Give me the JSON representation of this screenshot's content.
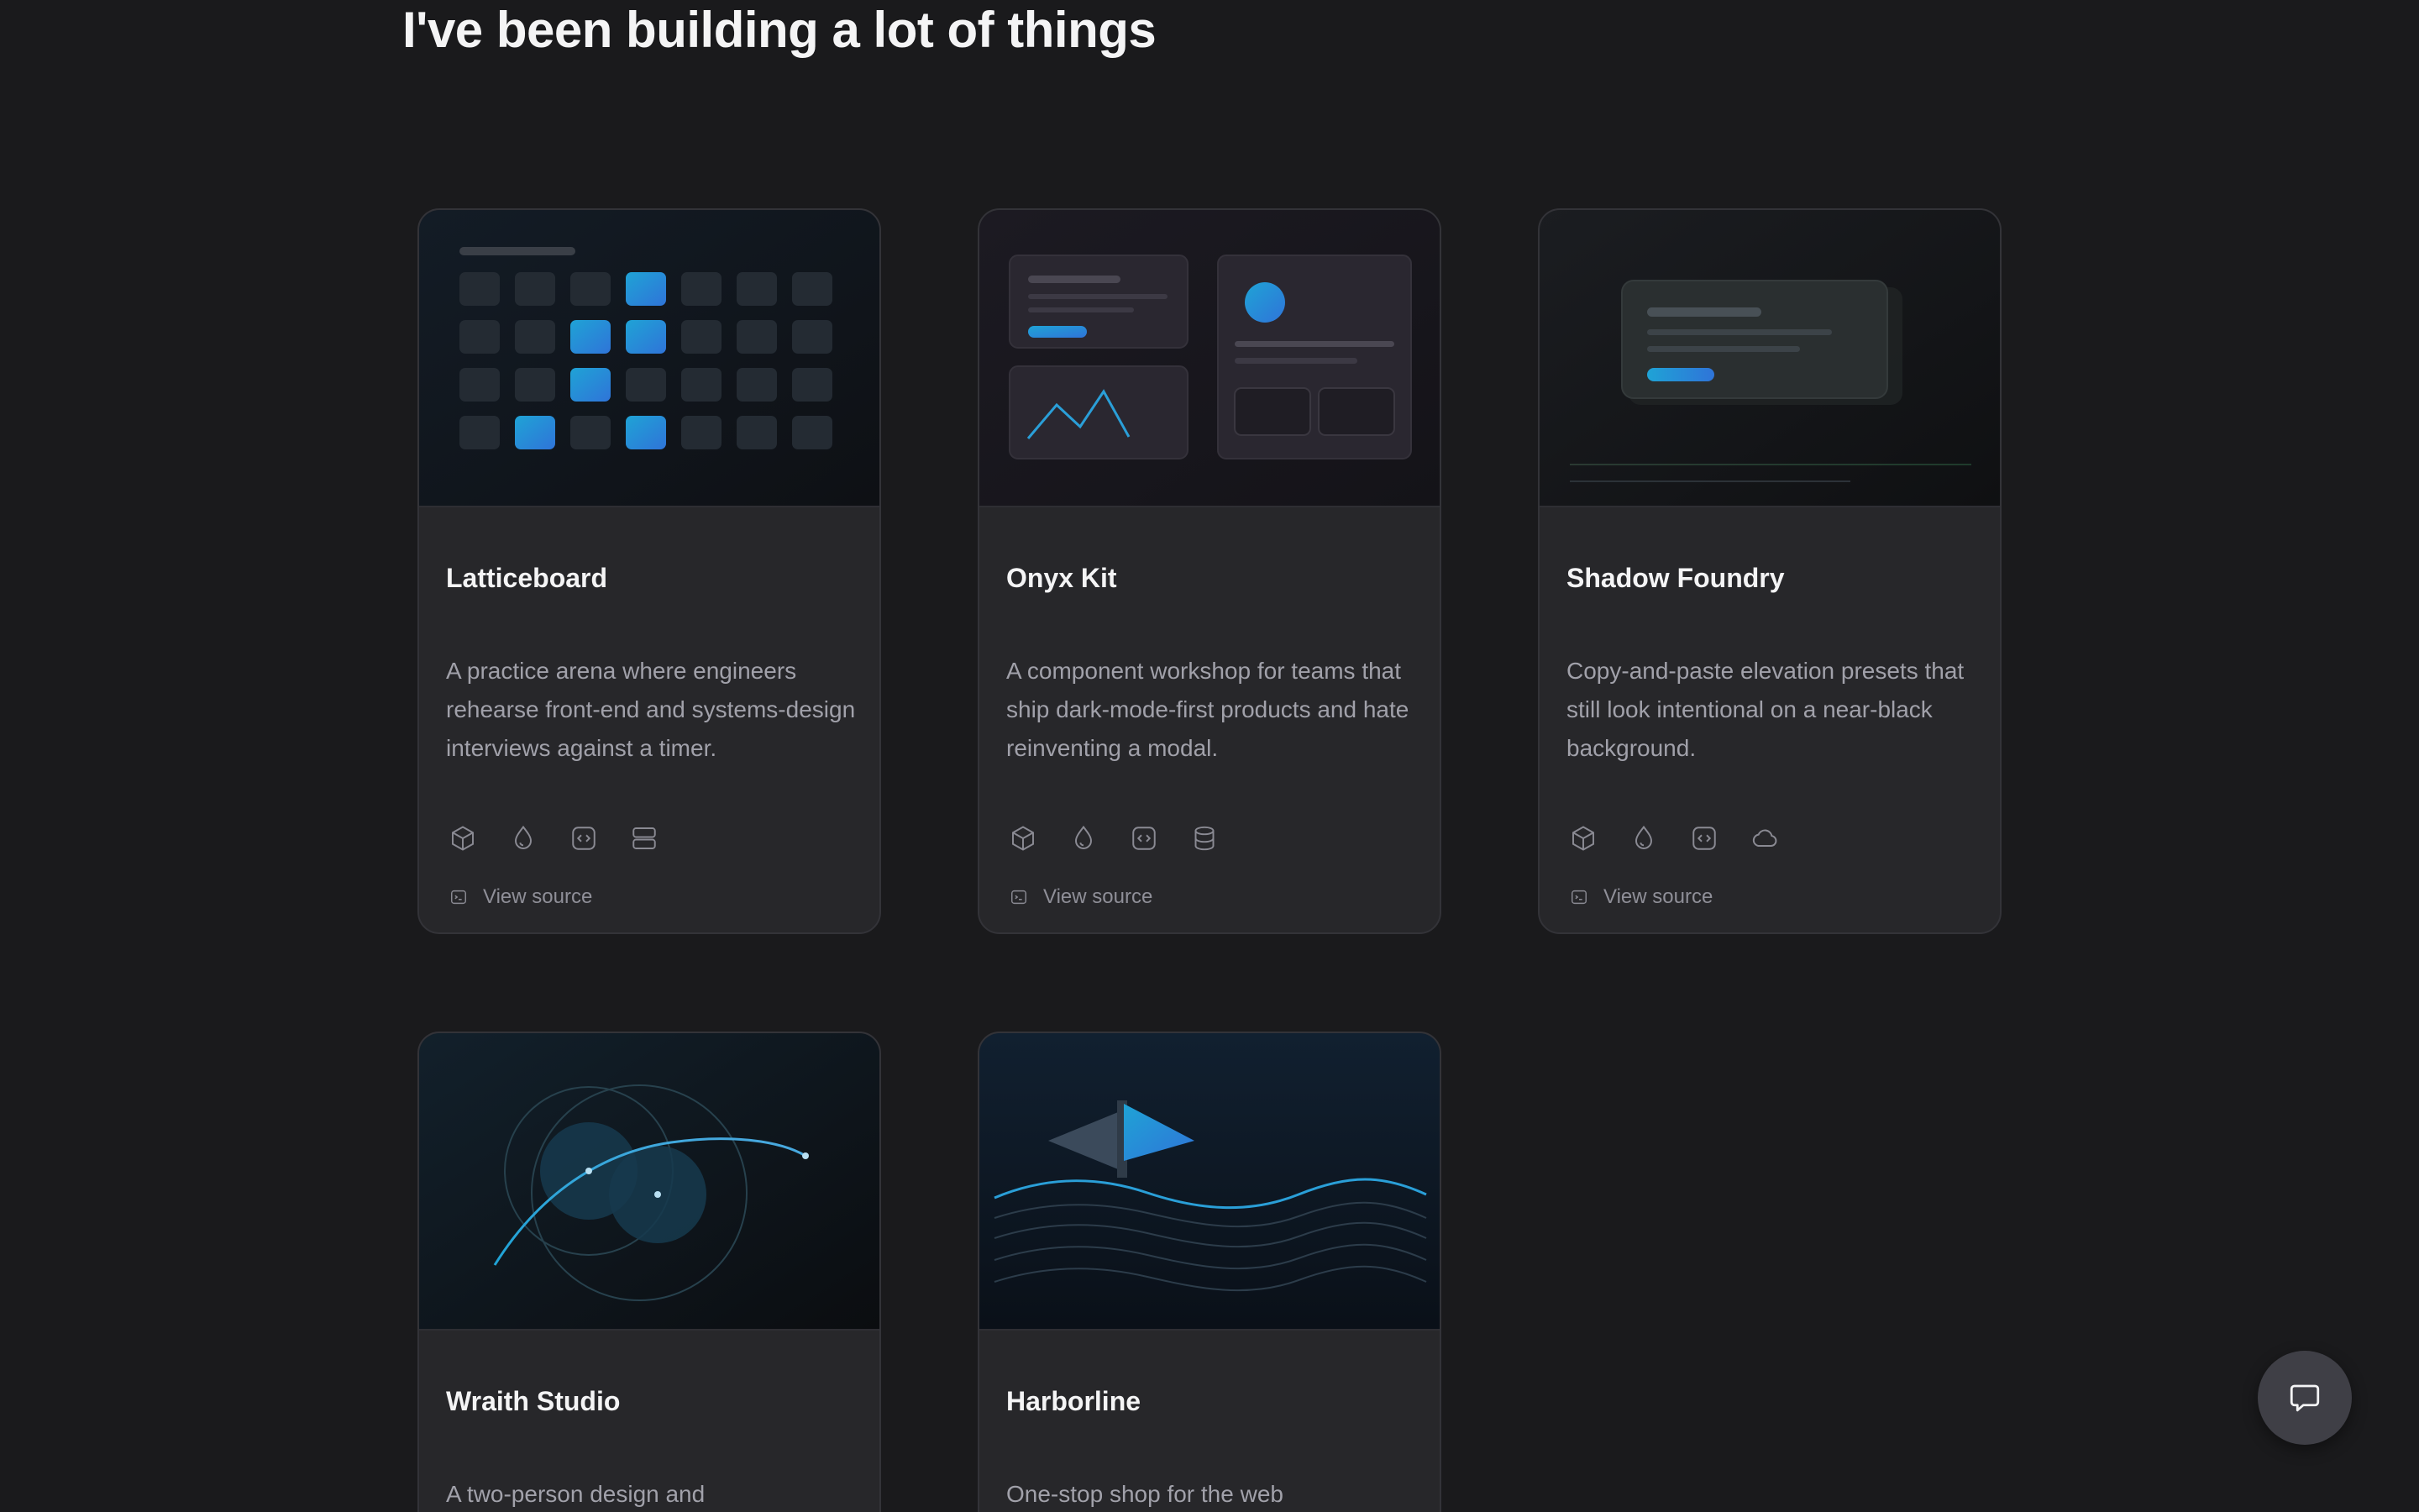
{
  "page": {
    "heading": "I've been building a lot of things"
  },
  "projects": [
    {
      "title": "Latticeboard",
      "description": "A practice arena where engineers rehearse front-end and systems-design interviews against a timer.",
      "tech_icons": [
        "cube-icon",
        "droplet-icon",
        "code-icon",
        "server-icon"
      ],
      "source_label": "View source"
    },
    {
      "title": "Onyx Kit",
      "description": "A component workshop for teams that ship dark-mode-first products and hate reinventing a modal.",
      "tech_icons": [
        "cube-icon",
        "droplet-icon",
        "code-icon",
        "database-icon"
      ],
      "source_label": "View source"
    },
    {
      "title": "Shadow Foundry",
      "description": "Copy-and-paste elevation presets that still look intentional on a near-black background.",
      "tech_icons": [
        "cube-icon",
        "droplet-icon",
        "code-icon",
        "cloud-icon"
      ],
      "source_label": "View source"
    },
    {
      "title": "Wraith Studio",
      "description": "A two-person design and"
    },
    {
      "title": "Harborline",
      "description": "One-stop shop for the web"
    }
  ],
  "chat": {
    "icon": "chat-bubble-icon"
  },
  "colors": {
    "background": "#1a1a1c",
    "card": "#27272a",
    "accent": "#2a9fd8"
  }
}
